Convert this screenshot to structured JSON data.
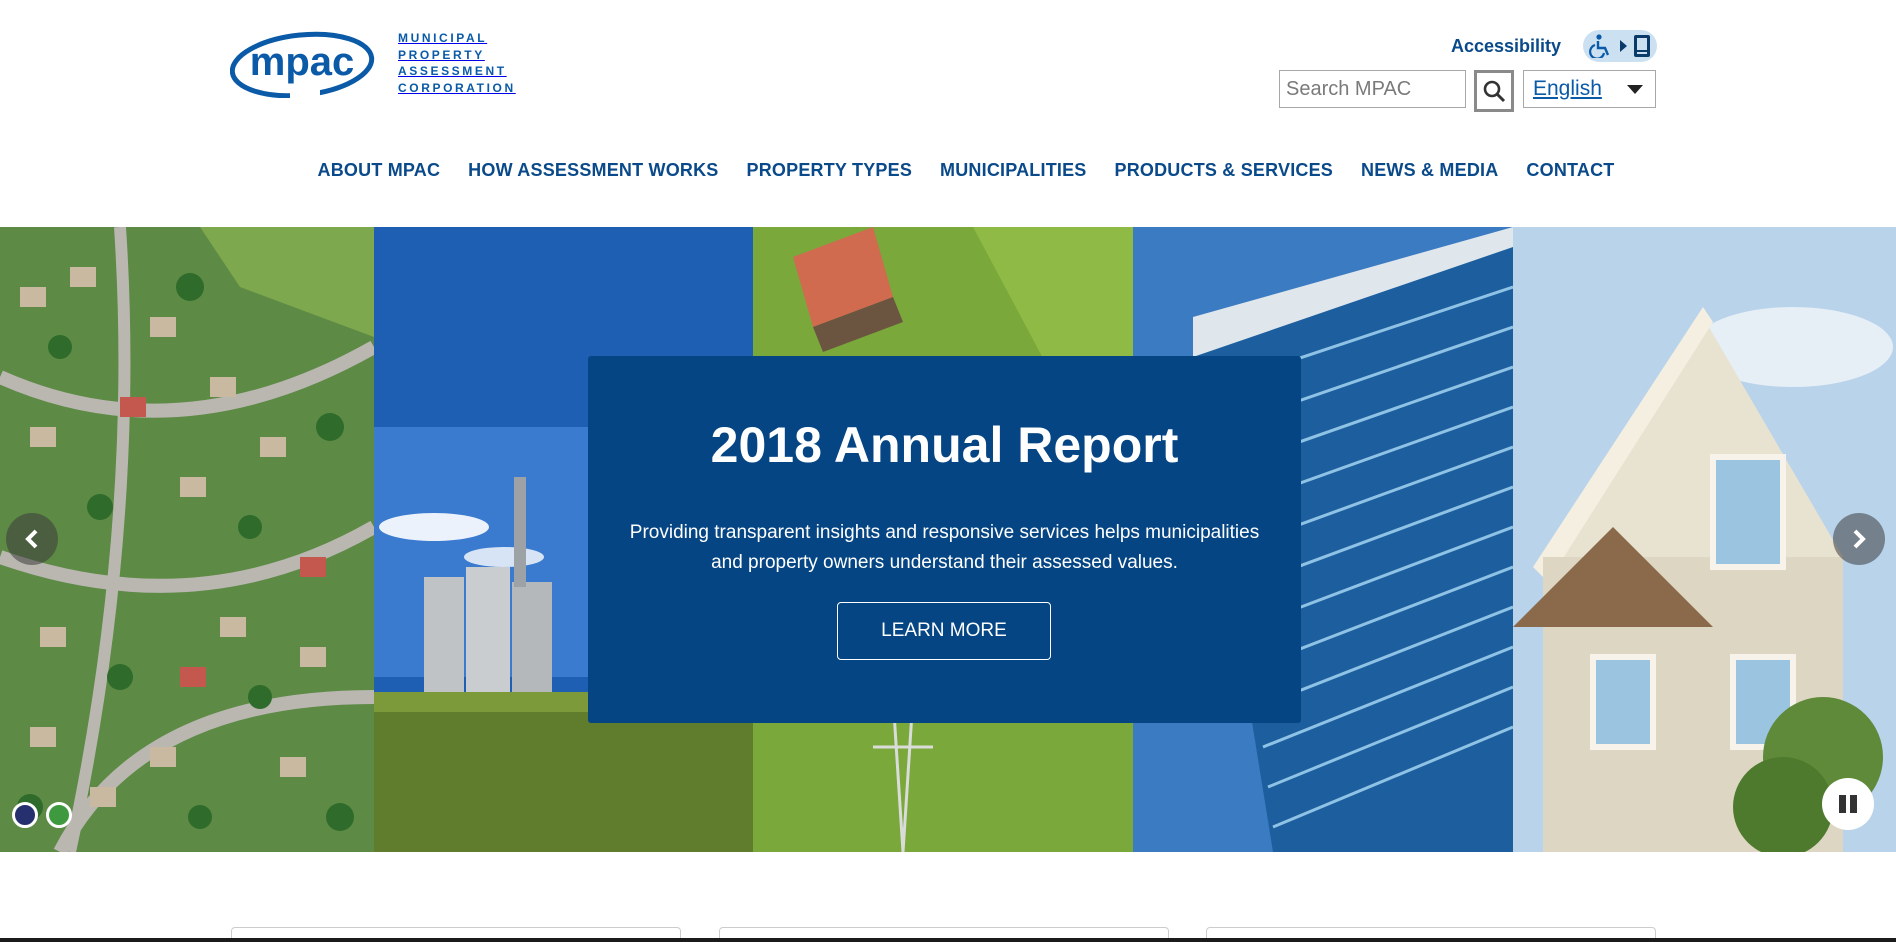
{
  "logo": {
    "mark_text": "mpac",
    "lines": [
      "MUNICIPAL",
      "PROPERTY",
      "ASSESSMENT",
      "CORPORATION"
    ],
    "brand_color": "#0a5aa8"
  },
  "utility": {
    "accessibility_label": "Accessibility",
    "accessibility_icons": [
      "wheelchair-icon",
      "play-arrow-icon",
      "device-icon"
    ],
    "search_placeholder": "Search MPAC",
    "search_icon": "search-icon",
    "language": "English"
  },
  "nav": {
    "items": [
      {
        "label": "ABOUT MPAC"
      },
      {
        "label": "HOW ASSESSMENT WORKS"
      },
      {
        "label": "PROPERTY TYPES"
      },
      {
        "label": "MUNICIPALITIES"
      },
      {
        "label": "PRODUCTS & SERVICES"
      },
      {
        "label": "NEWS & MEDIA"
      },
      {
        "label": "CONTACT"
      }
    ]
  },
  "hero": {
    "title": "2018 Annual Report",
    "body": "Providing transparent insights and responsive services helps municipalities and property owners understand their assessed values.",
    "cta": "LEARN MORE",
    "callout_color": "#054583",
    "slide_count": 2,
    "active_slide": 1
  },
  "colors": {
    "nav_text": "#0a4a8a",
    "accent": "#054583"
  }
}
